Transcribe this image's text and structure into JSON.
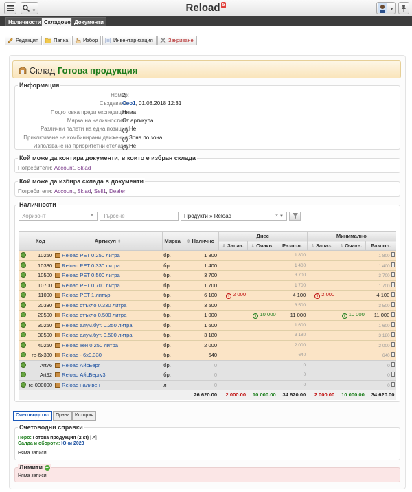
{
  "app": {
    "title": "Reload",
    "badge": "5"
  },
  "top_tabs": [
    "Наличности",
    "Складове",
    "Документи"
  ],
  "toolbar": [
    "Редакция",
    "Папка",
    "Избор",
    "Инвентаризация",
    "Закриване"
  ],
  "header": {
    "prefix": "Склад",
    "name": "Готова продукция"
  },
  "info": {
    "legend": "Информация",
    "rows": [
      {
        "label": "Номер:",
        "value": "2"
      },
      {
        "label": "Създаване:",
        "user": "Ceo1",
        "value": ", 01.08.2018 12:31"
      },
      {
        "label": "Подготовка преди експедиция:",
        "value": "Няма"
      },
      {
        "label": "Мярка на наличностите:",
        "value": "От артикула"
      },
      {
        "label": "Различни палети на една позиция:",
        "value": "Не",
        "info": true
      },
      {
        "label": "Приключване на комбинирани движения:",
        "value": "Зона по зона",
        "info": true
      },
      {
        "label": "Използване на приоритетни стелажи:",
        "value": "Не",
        "info": true
      }
    ]
  },
  "who_control": {
    "legend": "Кой може да контира документи, в които е избран склада",
    "label": "Потребители:",
    "users": [
      "Account",
      "Sklad"
    ]
  },
  "who_choose": {
    "legend": "Кой може да избира склада в документи",
    "label": "Потребители:",
    "users": [
      "Account",
      "Sklad",
      "Sell1",
      "Dealer"
    ]
  },
  "stock": {
    "legend": "Наличности",
    "filter_horizon": "Хоризонт",
    "filter_search": "Търсене",
    "filter_group": "Продукти » Reload",
    "group_today": "Днес",
    "group_min": "Минимално",
    "headers": {
      "code": "Код",
      "article": "Артикул",
      "unit": "Мярка",
      "qty": "Налично",
      "reserved": "Запаз.",
      "expected": "Очакв.",
      "available": "Разпол."
    },
    "rows": [
      {
        "code": "10250",
        "article": "Reload PET 0.250 литра",
        "unit": "бр.",
        "qty": "1 800",
        "t_res": "",
        "t_exp": "",
        "t_av": "1 800",
        "m_res": "",
        "m_exp": "",
        "m_av": "1 800",
        "style": "st"
      },
      {
        "code": "10330",
        "article": "Reload PET 0.330 литра",
        "unit": "бр.",
        "qty": "1 400",
        "t_res": "",
        "t_exp": "",
        "t_av": "1 400",
        "m_res": "",
        "m_exp": "",
        "m_av": "1 400",
        "style": "st"
      },
      {
        "code": "10500",
        "article": "Reload PET 0.500 литра",
        "unit": "бр.",
        "qty": "3 700",
        "t_res": "",
        "t_exp": "",
        "t_av": "3 700",
        "m_res": "",
        "m_exp": "",
        "m_av": "3 700",
        "style": "st"
      },
      {
        "code": "10700",
        "article": "Reload PET 0.700 литра",
        "unit": "бр.",
        "qty": "1 700",
        "t_res": "",
        "t_exp": "",
        "t_av": "1 700",
        "m_res": "",
        "m_exp": "",
        "m_av": "1 700",
        "style": "st"
      },
      {
        "code": "11000",
        "article": "Reload PET 1 литър",
        "unit": "бр.",
        "qty": "6 100",
        "t_res": "2 000",
        "t_exp": "",
        "t_av": "4 100",
        "m_res": "2 000",
        "m_exp": "",
        "m_av": "4 100",
        "style": "st",
        "bold_av": true
      },
      {
        "code": "20330",
        "article": "Reload стъкло 0.330 литра",
        "unit": "бр.",
        "qty": "3 500",
        "t_res": "",
        "t_exp": "",
        "t_av": "3 500",
        "m_res": "",
        "m_exp": "",
        "m_av": "3 500",
        "style": "st"
      },
      {
        "code": "20500",
        "article": "Reload стъкло 0.500 литра",
        "unit": "бр.",
        "qty": "1 000",
        "t_res": "",
        "t_exp": "10 000",
        "t_av": "11 000",
        "m_res": "",
        "m_exp": "10 000",
        "m_av": "11 000",
        "style": "st",
        "bold_av": true
      },
      {
        "code": "30250",
        "article": "Reload алум.бут. 0.250 литра",
        "unit": "бр.",
        "qty": "1 600",
        "t_res": "",
        "t_exp": "",
        "t_av": "1 600",
        "m_res": "",
        "m_exp": "",
        "m_av": "1 600",
        "style": "st"
      },
      {
        "code": "30500",
        "article": "Reload алум.бут. 0.500 литра",
        "unit": "бр.",
        "qty": "3 180",
        "t_res": "",
        "t_exp": "",
        "t_av": "3 180",
        "m_res": "",
        "m_exp": "",
        "m_av": "3 180",
        "style": "st"
      },
      {
        "code": "40250",
        "article": "Reload кен 0.250 литра",
        "unit": "бр.",
        "qty": "2 000",
        "t_res": "",
        "t_exp": "",
        "t_av": "2 000",
        "m_res": "",
        "m_exp": "",
        "m_av": "2 000",
        "style": "st"
      },
      {
        "code": "re-6x330",
        "article": "Reload - 6x0.330",
        "unit": "бр.",
        "qty": "640",
        "t_res": "",
        "t_exp": "",
        "t_av": "640",
        "m_res": "",
        "m_exp": "",
        "m_av": "640",
        "style": "st"
      },
      {
        "code": "Art76",
        "article": "Reload АйсБерг",
        "unit": "бр.",
        "qty": "0",
        "t_res": "",
        "t_exp": "",
        "t_av": "0",
        "m_res": "",
        "m_exp": "",
        "m_av": "0",
        "style": "stg",
        "zero": true
      },
      {
        "code": "Art92",
        "article": "Reload АйсБергv3",
        "unit": "бр.",
        "qty": "0",
        "t_res": "",
        "t_exp": "",
        "t_av": "0",
        "m_res": "",
        "m_exp": "",
        "m_av": "0",
        "style": "stg",
        "zero": true
      },
      {
        "code": "re-000000",
        "article": "Reload наливен",
        "unit": "л",
        "qty": "0",
        "t_res": "",
        "t_exp": "",
        "t_av": "0",
        "m_res": "",
        "m_exp": "",
        "m_av": "0",
        "style": "stg",
        "zero": true
      }
    ],
    "totals": {
      "qty": "26 620.00",
      "t_res": "2 000.00",
      "t_exp": "10 000.00",
      "t_av": "34 620.00",
      "m_res": "2 000.00",
      "m_exp": "10 000.00",
      "m_av": "34 620.00"
    }
  },
  "bottom_tabs": [
    "Счетоводство",
    "Права",
    "История"
  ],
  "accounting": {
    "legend": "Счетоводни справки",
    "line1_label": "Перо:",
    "line1_value": "Готова продукция (2 st)",
    "line2_label": "Салда и обороти:",
    "line2_value": "Юни 2023",
    "empty": "Няма записи"
  },
  "limits": {
    "legend": "Лимити",
    "empty": "Няма записи"
  }
}
